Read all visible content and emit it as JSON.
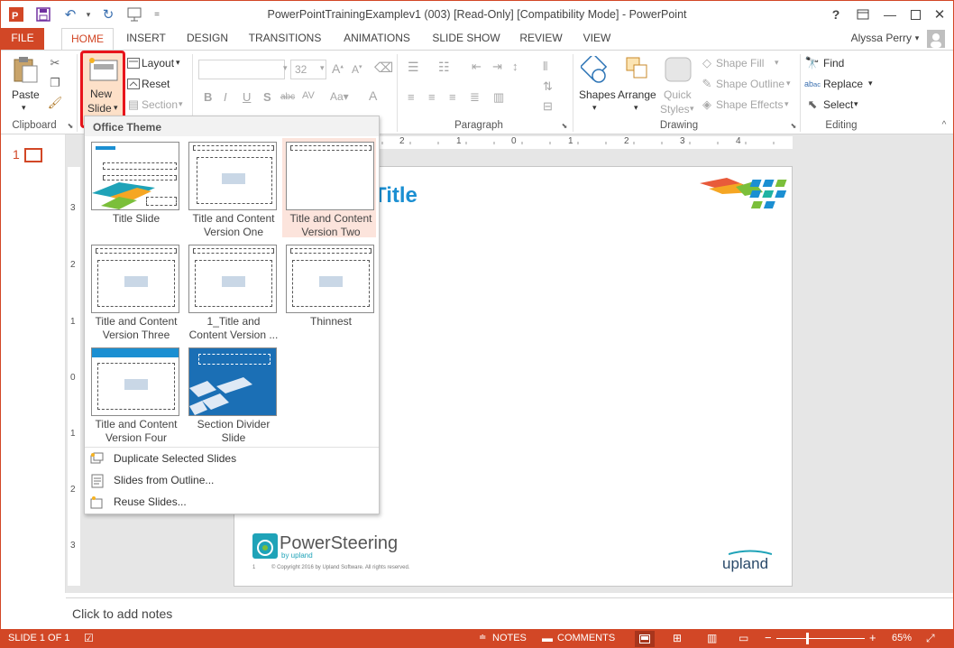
{
  "window": {
    "title": "PowerPointTrainingExamplev1 (003) [Read-Only] [Compatibility Mode] - PowerPoint",
    "help": "?",
    "user": "Alyssa Perry"
  },
  "tabs": [
    "FILE",
    "HOME",
    "INSERT",
    "DESIGN",
    "TRANSITIONS",
    "ANIMATIONS",
    "SLIDE SHOW",
    "REVIEW",
    "VIEW"
  ],
  "ribbon": {
    "clipboard": {
      "paste": "Paste",
      "label": "Clipboard"
    },
    "slides": {
      "new_slide_1": "New",
      "new_slide_2": "Slide",
      "layout": "Layout",
      "reset": "Reset",
      "section": "Section"
    },
    "font": {
      "size": "32"
    },
    "paragraph": {
      "label": "Paragraph"
    },
    "drawing": {
      "shapes": "Shapes",
      "arrange": "Arrange",
      "quick_styles_1": "Quick",
      "quick_styles_2": "Styles",
      "shape_fill": "Shape Fill",
      "shape_outline": "Shape Outline",
      "shape_effects": "Shape Effects",
      "label": "Drawing"
    },
    "editing": {
      "find": "Find",
      "replace": "Replace",
      "select": "Select",
      "label": "Editing"
    }
  },
  "gallery": {
    "header": "Office Theme",
    "layouts": [
      {
        "line1": "Title Slide",
        "line2": ""
      },
      {
        "line1": "Title and Content",
        "line2": "Version One"
      },
      {
        "line1": "Title and Content",
        "line2": "Version Two"
      },
      {
        "line1": "Title and Content",
        "line2": "Version Three"
      },
      {
        "line1": "1_Title and",
        "line2": "Content Version ..."
      },
      {
        "line1": "Thinnest",
        "line2": ""
      },
      {
        "line1": "Title and Content",
        "line2": "Version Four"
      },
      {
        "line1": "Section Divider",
        "line2": "Slide"
      }
    ],
    "menu": [
      "Duplicate Selected Slides",
      "Slides from Outline...",
      "Reuse Slides..."
    ]
  },
  "thumbnail": {
    "number": "1"
  },
  "slide": {
    "title_fragment": "Title",
    "brand": "PowerSteering",
    "brand_sub": "by upland",
    "copyright": "© Copyright 2016 by Upland Software. All rights reserved.",
    "page_num": "1",
    "footer_logo": "upland"
  },
  "ruler_h": [
    "2",
    "1",
    "0",
    "1",
    "2",
    "3",
    "4"
  ],
  "ruler_v": [
    "3",
    "2",
    "1",
    "0",
    "1",
    "2",
    "3"
  ],
  "notes": {
    "placeholder": "Click to add notes"
  },
  "status": {
    "slide": "SLIDE 1 OF 1",
    "notes": "NOTES",
    "comments": "COMMENTS",
    "zoom": "65%",
    "zoom_minus": "−",
    "zoom_plus": "+"
  },
  "colors": {
    "accent": "#d24726",
    "slide_blue": "#1b8fd2"
  }
}
